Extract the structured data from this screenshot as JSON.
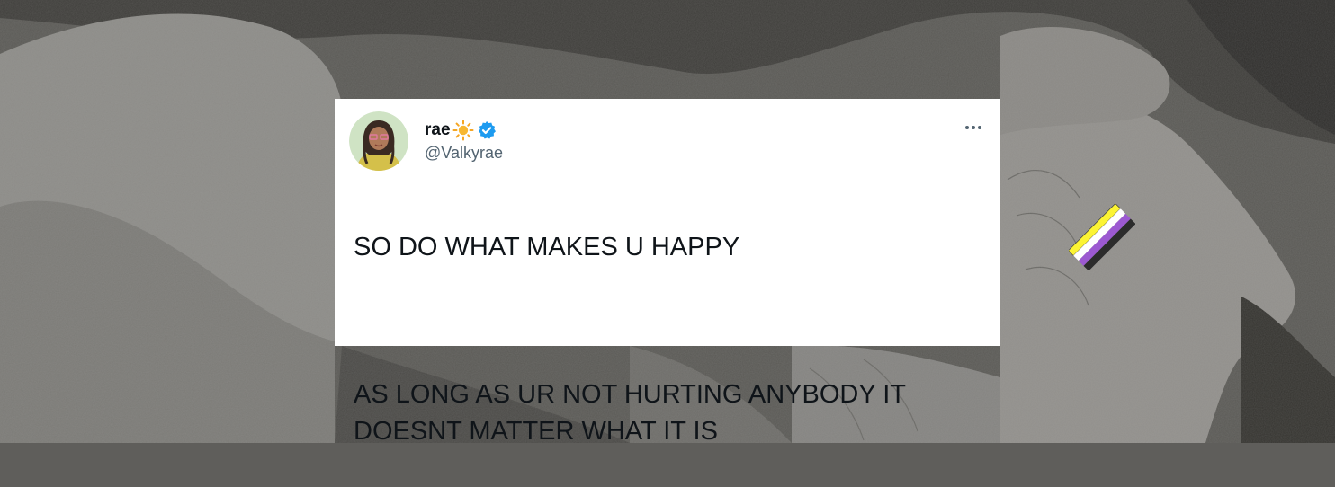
{
  "tweet": {
    "display_name": "rae",
    "handle": "@Valkyrae",
    "lines": [
      "SO DO WHAT MAKES U HAPPY",
      "AS LONG AS UR NOT HURTING ANYBODY IT DOESNT MATTER WHAT IT IS"
    ],
    "icons": {
      "name_emoji": "sun-icon",
      "badge": "verified-badge-icon",
      "menu": "more-options-icon"
    },
    "colors": {
      "verified": "#1d9bf0",
      "sun": "#f5a623",
      "text": "#0f1419",
      "handle": "#536471"
    }
  },
  "background": {
    "flag_stripes": [
      "#fcf434",
      "#ffffff",
      "#9c59d1",
      "#2c2c2c"
    ]
  }
}
